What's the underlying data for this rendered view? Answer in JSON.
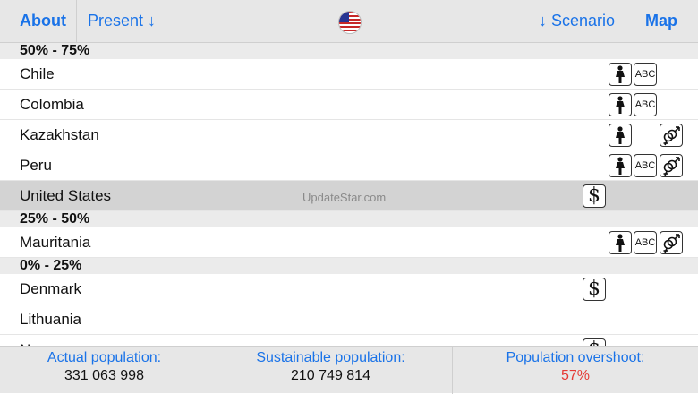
{
  "toolbar": {
    "about": "About",
    "present": "Present ↓",
    "scenario": "↓ Scenario",
    "map": "Map",
    "flag_icon": "us-flag-icon"
  },
  "sections": [
    {
      "title": "50% - 75%",
      "rows": [
        {
          "name": "Chile",
          "icons": [
            "woman-icon",
            "abc-icon"
          ]
        },
        {
          "name": "Colombia",
          "icons": [
            "woman-icon",
            "abc-icon"
          ]
        },
        {
          "name": "Kazakhstan",
          "icons": [
            "woman-icon",
            "gender-icon"
          ]
        },
        {
          "name": "Peru",
          "icons": [
            "woman-icon",
            "abc-icon",
            "gender-icon"
          ]
        },
        {
          "name": "United States",
          "icons": [
            "dollar-icon"
          ],
          "selected": true
        }
      ]
    },
    {
      "title": "25% - 50%",
      "rows": [
        {
          "name": "Mauritania",
          "icons": [
            "woman-icon",
            "abc-icon",
            "gender-icon"
          ]
        }
      ]
    },
    {
      "title": "0% - 25%",
      "rows": [
        {
          "name": "Denmark",
          "icons": [
            "dollar-icon"
          ]
        },
        {
          "name": "Lithuania",
          "icons": []
        },
        {
          "name": "Norway",
          "icons": [
            "dollar-icon"
          ]
        }
      ]
    }
  ],
  "icon_labels": {
    "abc": "ABC",
    "dollar": "$"
  },
  "watermark": "UpdateStar.com",
  "footer": {
    "actual_label": "Actual population:",
    "actual_value": "331 063 998",
    "sustainable_label": "Sustainable population:",
    "sustainable_value": "210 749 814",
    "overshoot_label": "Population overshoot:",
    "overshoot_value": "57%"
  },
  "colors": {
    "accent": "#1a73e8",
    "overshoot": "#e53935",
    "selected_row": "#d3d3d3"
  }
}
